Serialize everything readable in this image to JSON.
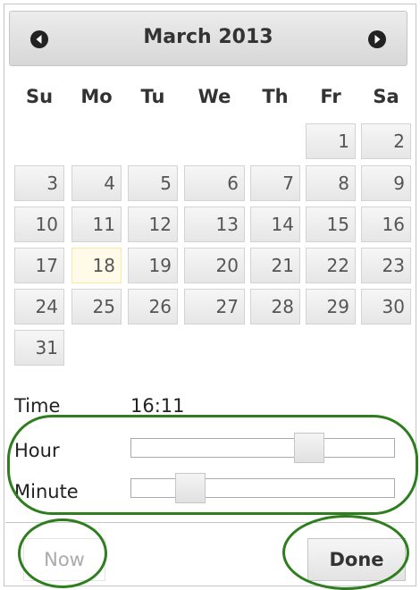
{
  "header": {
    "month_year": "March 2013",
    "prev_icon": "arrow-left-circle-icon",
    "next_icon": "arrow-right-circle-icon"
  },
  "weekdays": [
    "Su",
    "Mo",
    "Tu",
    "We",
    "Th",
    "Fr",
    "Sa"
  ],
  "days": [
    [
      "",
      "",
      "",
      "",
      "",
      "1",
      "2"
    ],
    [
      "3",
      "4",
      "5",
      "6",
      "7",
      "8",
      "9"
    ],
    [
      "10",
      "11",
      "12",
      "13",
      "14",
      "15",
      "16"
    ],
    [
      "17",
      "18",
      "19",
      "20",
      "21",
      "22",
      "23"
    ],
    [
      "24",
      "25",
      "26",
      "27",
      "28",
      "29",
      "30"
    ],
    [
      "31",
      "",
      "",
      "",
      "",
      "",
      ""
    ]
  ],
  "today": "18",
  "time": {
    "label": "Time",
    "value": "16:11"
  },
  "hour": {
    "label": "Hour",
    "value": 16,
    "max": 23
  },
  "minute": {
    "label": "Minute",
    "value": 11,
    "max": 59
  },
  "buttons": {
    "now": "Now",
    "done": "Done"
  },
  "colors": {
    "annotation": "#2e7d1e",
    "today_bg": "#fffbe8"
  }
}
